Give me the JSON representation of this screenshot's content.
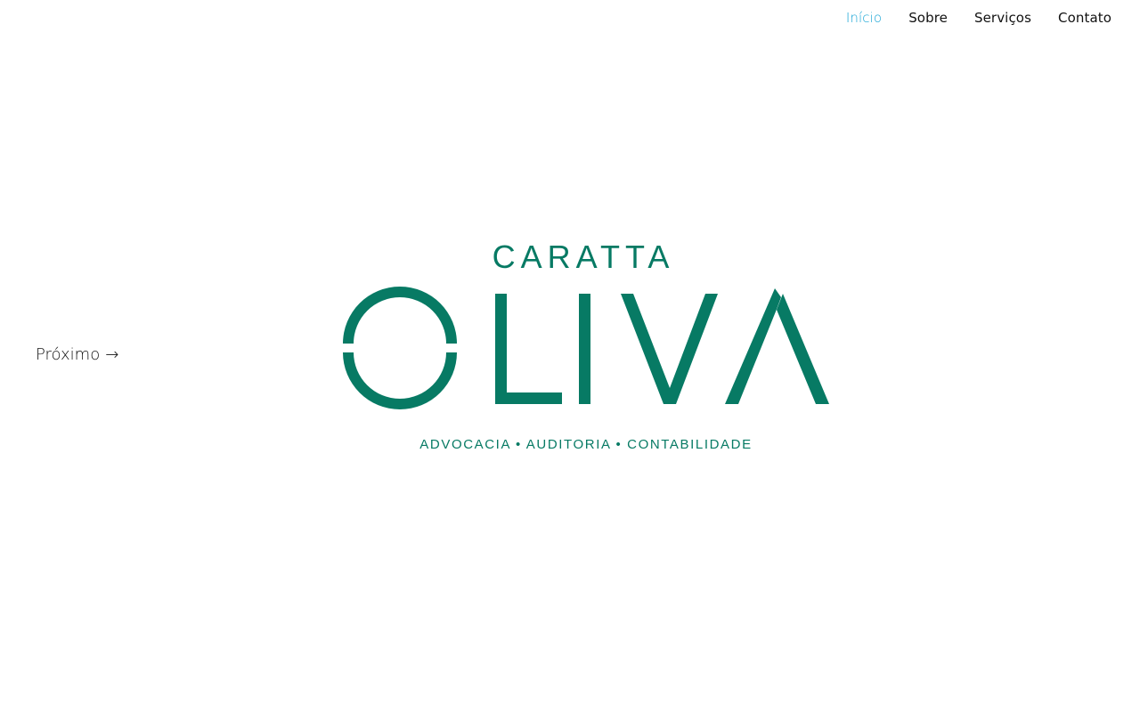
{
  "nav": {
    "items": [
      {
        "label": "Início",
        "active": true
      },
      {
        "label": "Sobre",
        "active": false
      },
      {
        "label": "Serviços",
        "active": false
      },
      {
        "label": "Contato",
        "active": false
      }
    ]
  },
  "slider": {
    "next_label": "Próximo",
    "next_icon": "arrow-right-icon"
  },
  "logo": {
    "top_text": "CARATTA",
    "main_text": "OLIVA",
    "tagline": "ADVOCACIA • AUDITORIA • CONTABILIDADE"
  },
  "colors": {
    "brand_green": "#077a64",
    "nav_active": "#1aa6d6",
    "text": "#111111",
    "background": "#ffffff"
  }
}
